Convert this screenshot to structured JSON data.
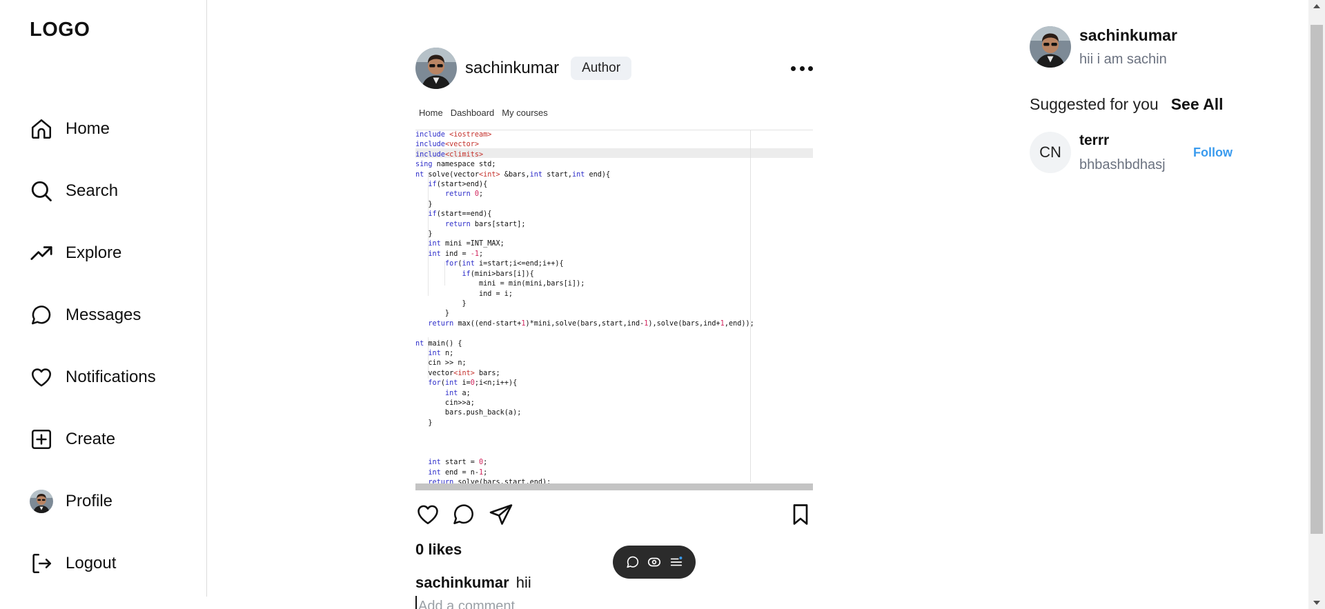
{
  "sidebar": {
    "logo": "LOGO",
    "items": [
      {
        "label": "Home",
        "icon": "home-icon"
      },
      {
        "label": "Search",
        "icon": "search-icon"
      },
      {
        "label": "Explore",
        "icon": "trending-up-icon"
      },
      {
        "label": "Messages",
        "icon": "message-icon"
      },
      {
        "label": "Notifications",
        "icon": "heart-icon"
      },
      {
        "label": "Create",
        "icon": "plus-square-icon"
      },
      {
        "label": "Profile",
        "icon": "avatar"
      },
      {
        "label": "Logout",
        "icon": "logout-icon"
      }
    ]
  },
  "post": {
    "username": "sachinkumar",
    "badge": "Author",
    "image_nav": [
      "Home",
      "Dashboard",
      "My courses"
    ],
    "likes": "0 likes",
    "caption_user": "sachinkumar",
    "caption_text": "hii",
    "comment_placeholder": "Add a comment"
  },
  "profile": {
    "username": "sachinkumar",
    "bio": "hii i am sachin"
  },
  "suggestions": {
    "title": "Suggested for you",
    "see_all": "See All",
    "users": [
      {
        "initials": "CN",
        "username": "terrr",
        "subtitle": "bhbashbdhasj",
        "action": "Follow"
      }
    ]
  },
  "colors": {
    "follow": "#3a9bee",
    "badge_bg": "#eef1f5",
    "floating_bar": "#2b2b2b"
  }
}
